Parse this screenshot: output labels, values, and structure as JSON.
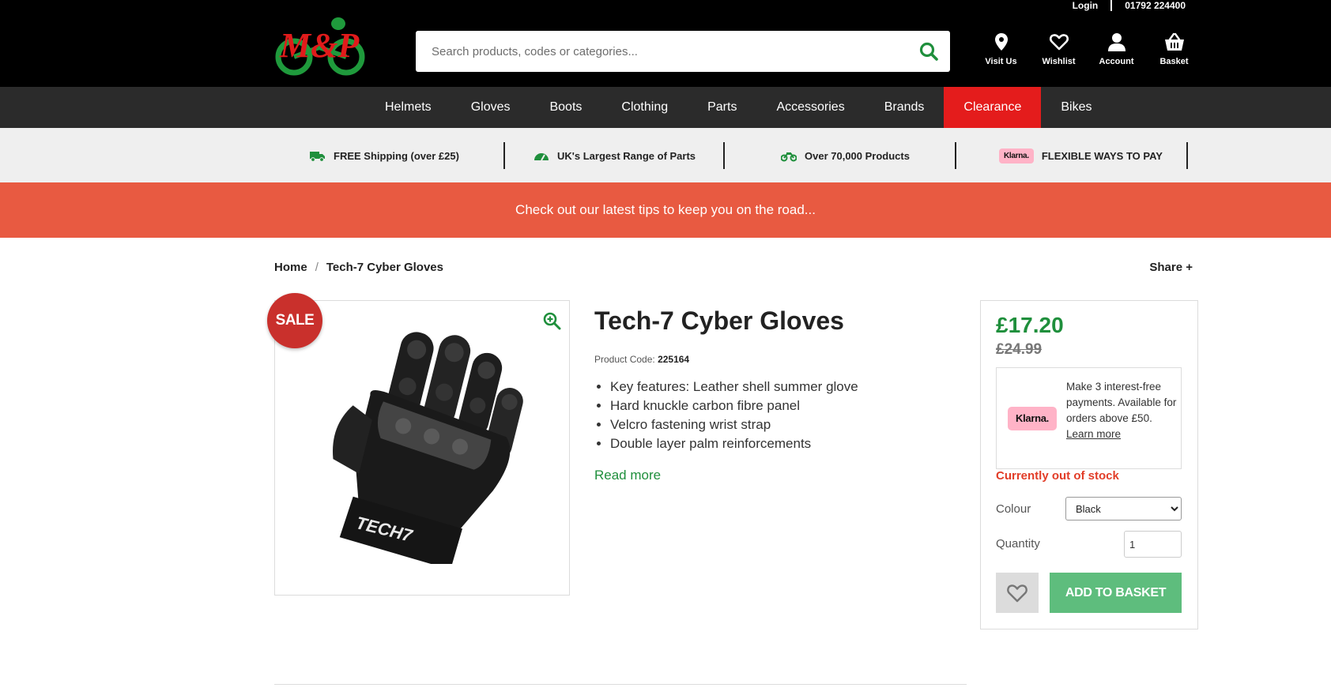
{
  "header": {
    "top_links": {
      "login": "Login",
      "phone": "01792 224400"
    },
    "logo_alt": "M&P",
    "search": {
      "placeholder": "Search products, codes or categories..."
    },
    "icons": [
      {
        "label": "Visit Us",
        "icon": "location-pin-icon"
      },
      {
        "label": "Wishlist",
        "icon": "heart-icon"
      },
      {
        "label": "Account",
        "icon": "user-icon"
      },
      {
        "label": "Basket",
        "icon": "basket-icon"
      }
    ]
  },
  "nav": {
    "items": [
      "Helmets",
      "Gloves",
      "Boots",
      "Clothing",
      "Parts",
      "Accessories",
      "Brands",
      "Clearance",
      "Bikes"
    ],
    "active": "Clearance",
    "active_color": "#e41c1c"
  },
  "usp": [
    {
      "text": "FREE Shipping (over £25)",
      "icon": "truck-icon"
    },
    {
      "text": "UK's Largest Range of Parts",
      "icon": "gauge-icon"
    },
    {
      "text": "Over 70,000 Products",
      "icon": "motorbike-icon"
    },
    {
      "text": "FLEXIBLE WAYS TO PAY",
      "icon": "klarna-badge",
      "badge": "Klarna."
    }
  ],
  "banner": {
    "text": "Check out our latest tips to keep you on the road...",
    "color": "#e85a41"
  },
  "breadcrumb": {
    "home": "Home",
    "current": "Tech-7 Cyber Gloves",
    "share": "Share +"
  },
  "product": {
    "sale_badge": "SALE",
    "title": "Tech-7 Cyber Gloves",
    "code_label": "Product Code:",
    "code": "225164",
    "features": [
      "Key features: Leather shell summer glove",
      "Hard knuckle carbon fibre panel",
      "Velcro fastening wrist strap",
      "Double layer palm reinforcements"
    ],
    "read_more": "Read more"
  },
  "buybox": {
    "price": "£17.20",
    "old_price": "£24.99",
    "klarna": {
      "badge": "Klarna.",
      "text": "Make 3 interest-free payments. Available for orders above £50.",
      "link": "Learn more"
    },
    "stock_status": "Currently out of stock",
    "colour_label": "Colour",
    "colour_value": "Black",
    "quantity_label": "Quantity",
    "quantity_value": "1",
    "add_to_basket": "ADD TO BASKET",
    "price_color": "#1f8f3c",
    "button_color": "#5ebd7d"
  }
}
